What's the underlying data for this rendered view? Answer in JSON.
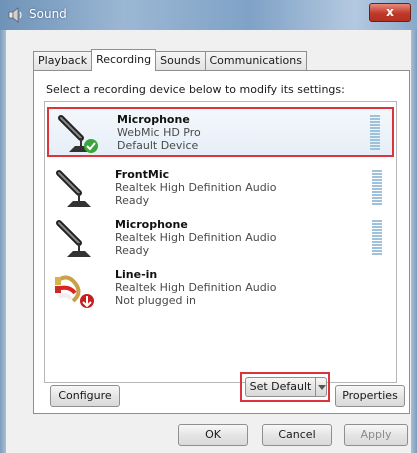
{
  "window": {
    "title": "Sound",
    "close_glyph": "x"
  },
  "tabs": [
    {
      "label": "Playback",
      "active": false
    },
    {
      "label": "Recording",
      "active": true
    },
    {
      "label": "Sounds",
      "active": false
    },
    {
      "label": "Communications",
      "active": false
    }
  ],
  "instruction": "Select a recording device below to modify its settings:",
  "devices": [
    {
      "name": "Microphone",
      "driver": "WebMic HD Pro",
      "status": "Default Device",
      "icon": "microphone-icon",
      "badge": "green-check-icon",
      "selected": true
    },
    {
      "name": "FrontMic",
      "driver": "Realtek High Definition Audio",
      "status": "Ready",
      "icon": "microphone-icon",
      "selected": false
    },
    {
      "name": "Microphone",
      "driver": "Realtek High Definition Audio",
      "status": "Ready",
      "icon": "microphone-icon",
      "selected": false
    },
    {
      "name": "Line-in",
      "driver": "Realtek High Definition Audio",
      "status": "Not plugged in",
      "icon": "line-in-cable-icon",
      "badge": "red-down-arrow-icon",
      "selected": false
    }
  ],
  "buttons": {
    "configure": "Configure",
    "set_default": "Set Default",
    "properties": "Properties",
    "ok": "OK",
    "cancel": "Cancel",
    "apply": "Apply"
  },
  "colors": {
    "highlight_box": "#d9363b",
    "meter": "#9fc1da",
    "default_check": "#3aa53a",
    "unplugged_badge": "#c81e1e"
  }
}
